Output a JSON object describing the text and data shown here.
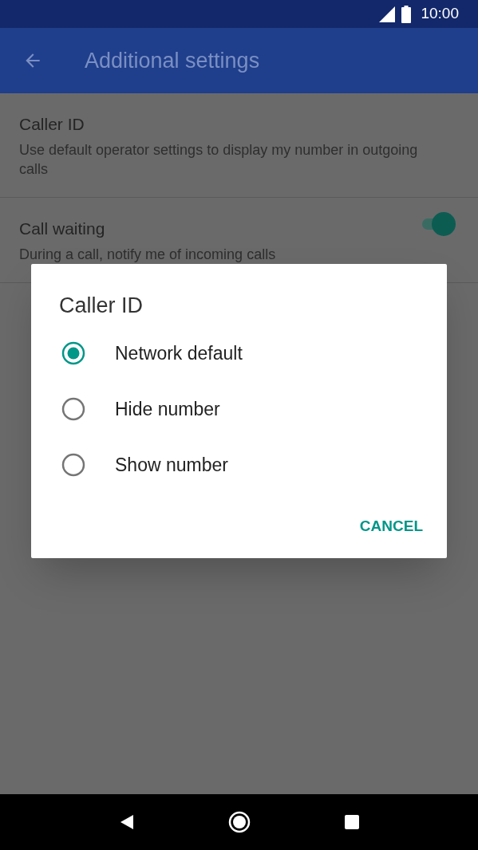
{
  "status_bar": {
    "time": "10:00"
  },
  "app_bar": {
    "title": "Additional settings"
  },
  "settings": [
    {
      "kind": "text",
      "title": "Caller ID",
      "summary": "Use default operator settings to display my number in outgoing calls"
    },
    {
      "kind": "switch",
      "title": "Call waiting",
      "summary": "During a call, notify me of incoming calls",
      "on": true
    }
  ],
  "dialog": {
    "title": "Caller ID",
    "options": [
      {
        "label": "Network default",
        "selected": true
      },
      {
        "label": "Hide number",
        "selected": false
      },
      {
        "label": "Show number",
        "selected": false
      }
    ],
    "buttons": [
      "CANCEL"
    ]
  }
}
